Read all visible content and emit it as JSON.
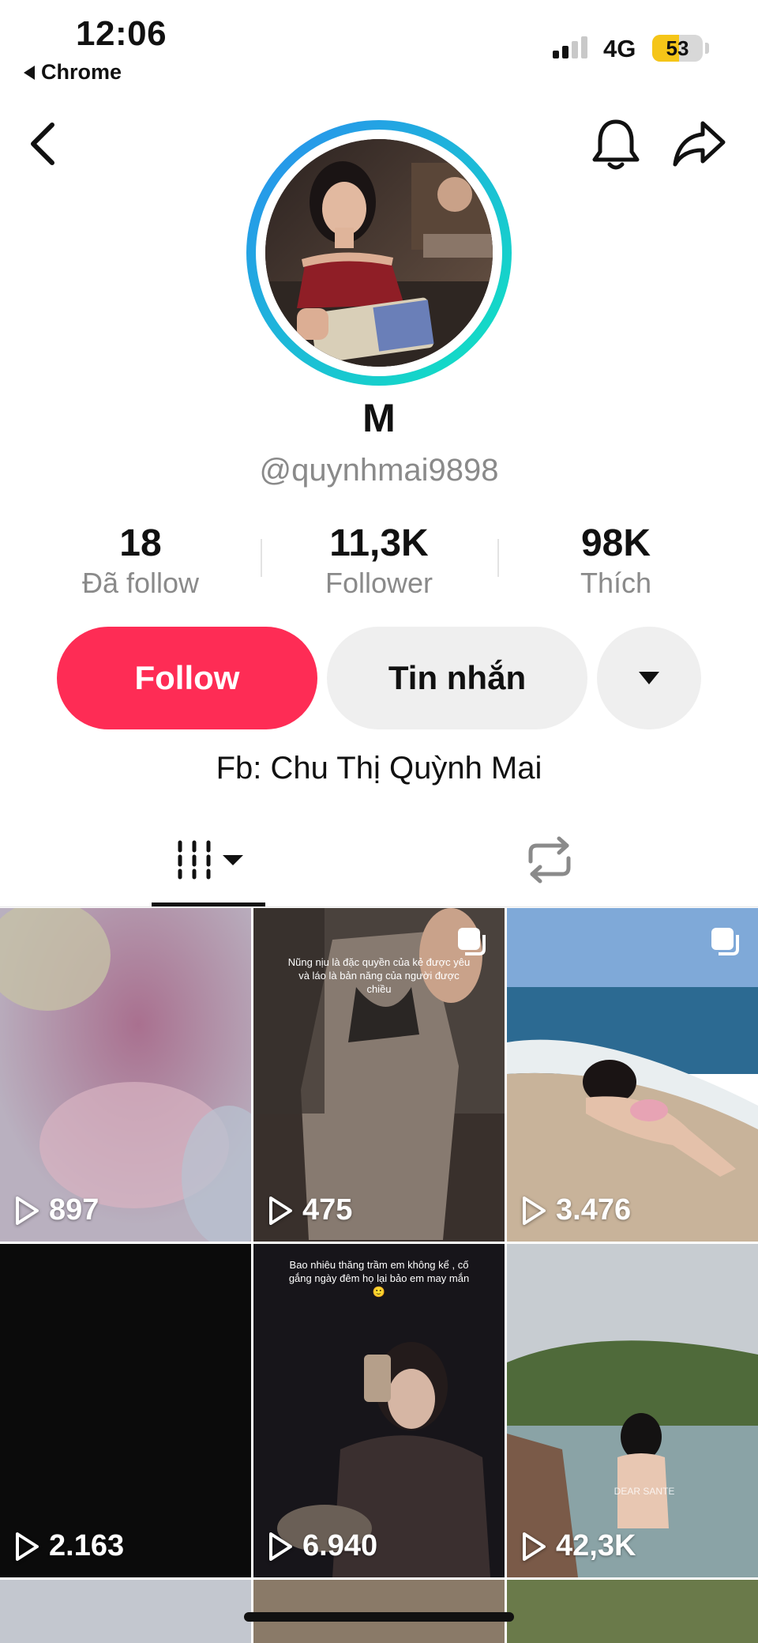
{
  "status_bar": {
    "time": "12:06",
    "back_app": "Chrome",
    "network": "4G",
    "battery": "53",
    "battery_level": 0.53,
    "battery_color": "#f5c518"
  },
  "header": {
    "back_icon": "chevron-left-icon",
    "bell_icon": "bell-icon",
    "share_icon": "share-arrow-icon"
  },
  "profile": {
    "display_name": "M",
    "username": "@quynhmai9898",
    "ring_colors": [
      "#2a8cf0",
      "#10e6c0"
    ]
  },
  "stats": [
    {
      "value": "18",
      "label": "Đã follow"
    },
    {
      "value": "11,3K",
      "label": "Follower"
    },
    {
      "value": "98K",
      "label": "Thích"
    }
  ],
  "actions": {
    "follow": "Follow",
    "message": "Tin nhắn",
    "follow_color": "#fe2c55"
  },
  "bio": "Fb: Chu Thị Quỳnh Mai",
  "tabs": [
    {
      "icon": "videos-grid-icon",
      "active": true
    },
    {
      "icon": "repost-icon",
      "active": false
    }
  ],
  "videos": [
    {
      "views": "897"
    },
    {
      "views": "475",
      "caption": "Nũng nịu là đặc quyền của kẻ được yêu và láo là bản năng của người được chiều"
    },
    {
      "views": "3.476"
    },
    {
      "views": "2.163"
    },
    {
      "views": "6.940",
      "caption": "Bao nhiêu thăng trầm em không kể , cố gắng ngày đêm họ lại bảo em may mắn 🙂"
    },
    {
      "views": "42,3K",
      "caption": "DEAR SANTE"
    }
  ]
}
